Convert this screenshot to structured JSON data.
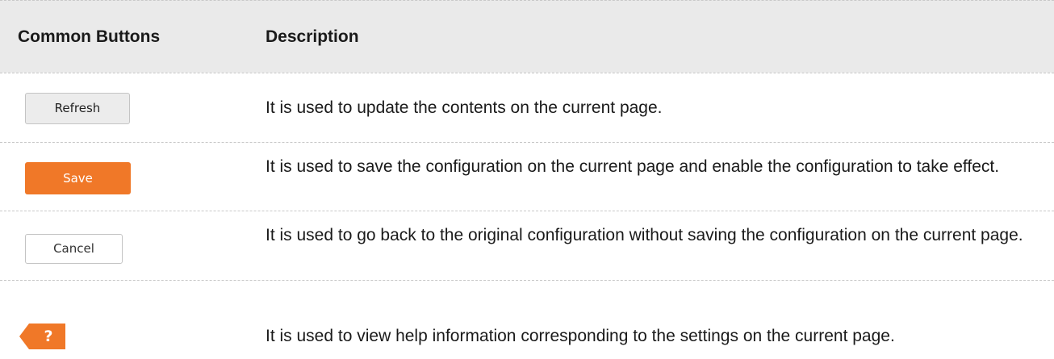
{
  "table": {
    "headers": {
      "col1": "Common Buttons",
      "col2": "Description"
    },
    "rows": [
      {
        "button_label": "Refresh",
        "description": "It is used to update the contents on the current page."
      },
      {
        "button_label": "Save",
        "description": "It is used to save the configuration on the current page and enable the configuration to take effect."
      },
      {
        "button_label": "Cancel",
        "description": "It is used to go back to the original configuration without saving the configuration on the current page."
      },
      {
        "button_label": "?",
        "icon": "help-icon",
        "description": "It is used to view help information corresponding to the settings on the current page."
      }
    ]
  },
  "colors": {
    "header_bg": "#eaeaea",
    "save_bg": "#f07828",
    "help_bg": "#f07828",
    "divider": "#c8c8c8"
  }
}
